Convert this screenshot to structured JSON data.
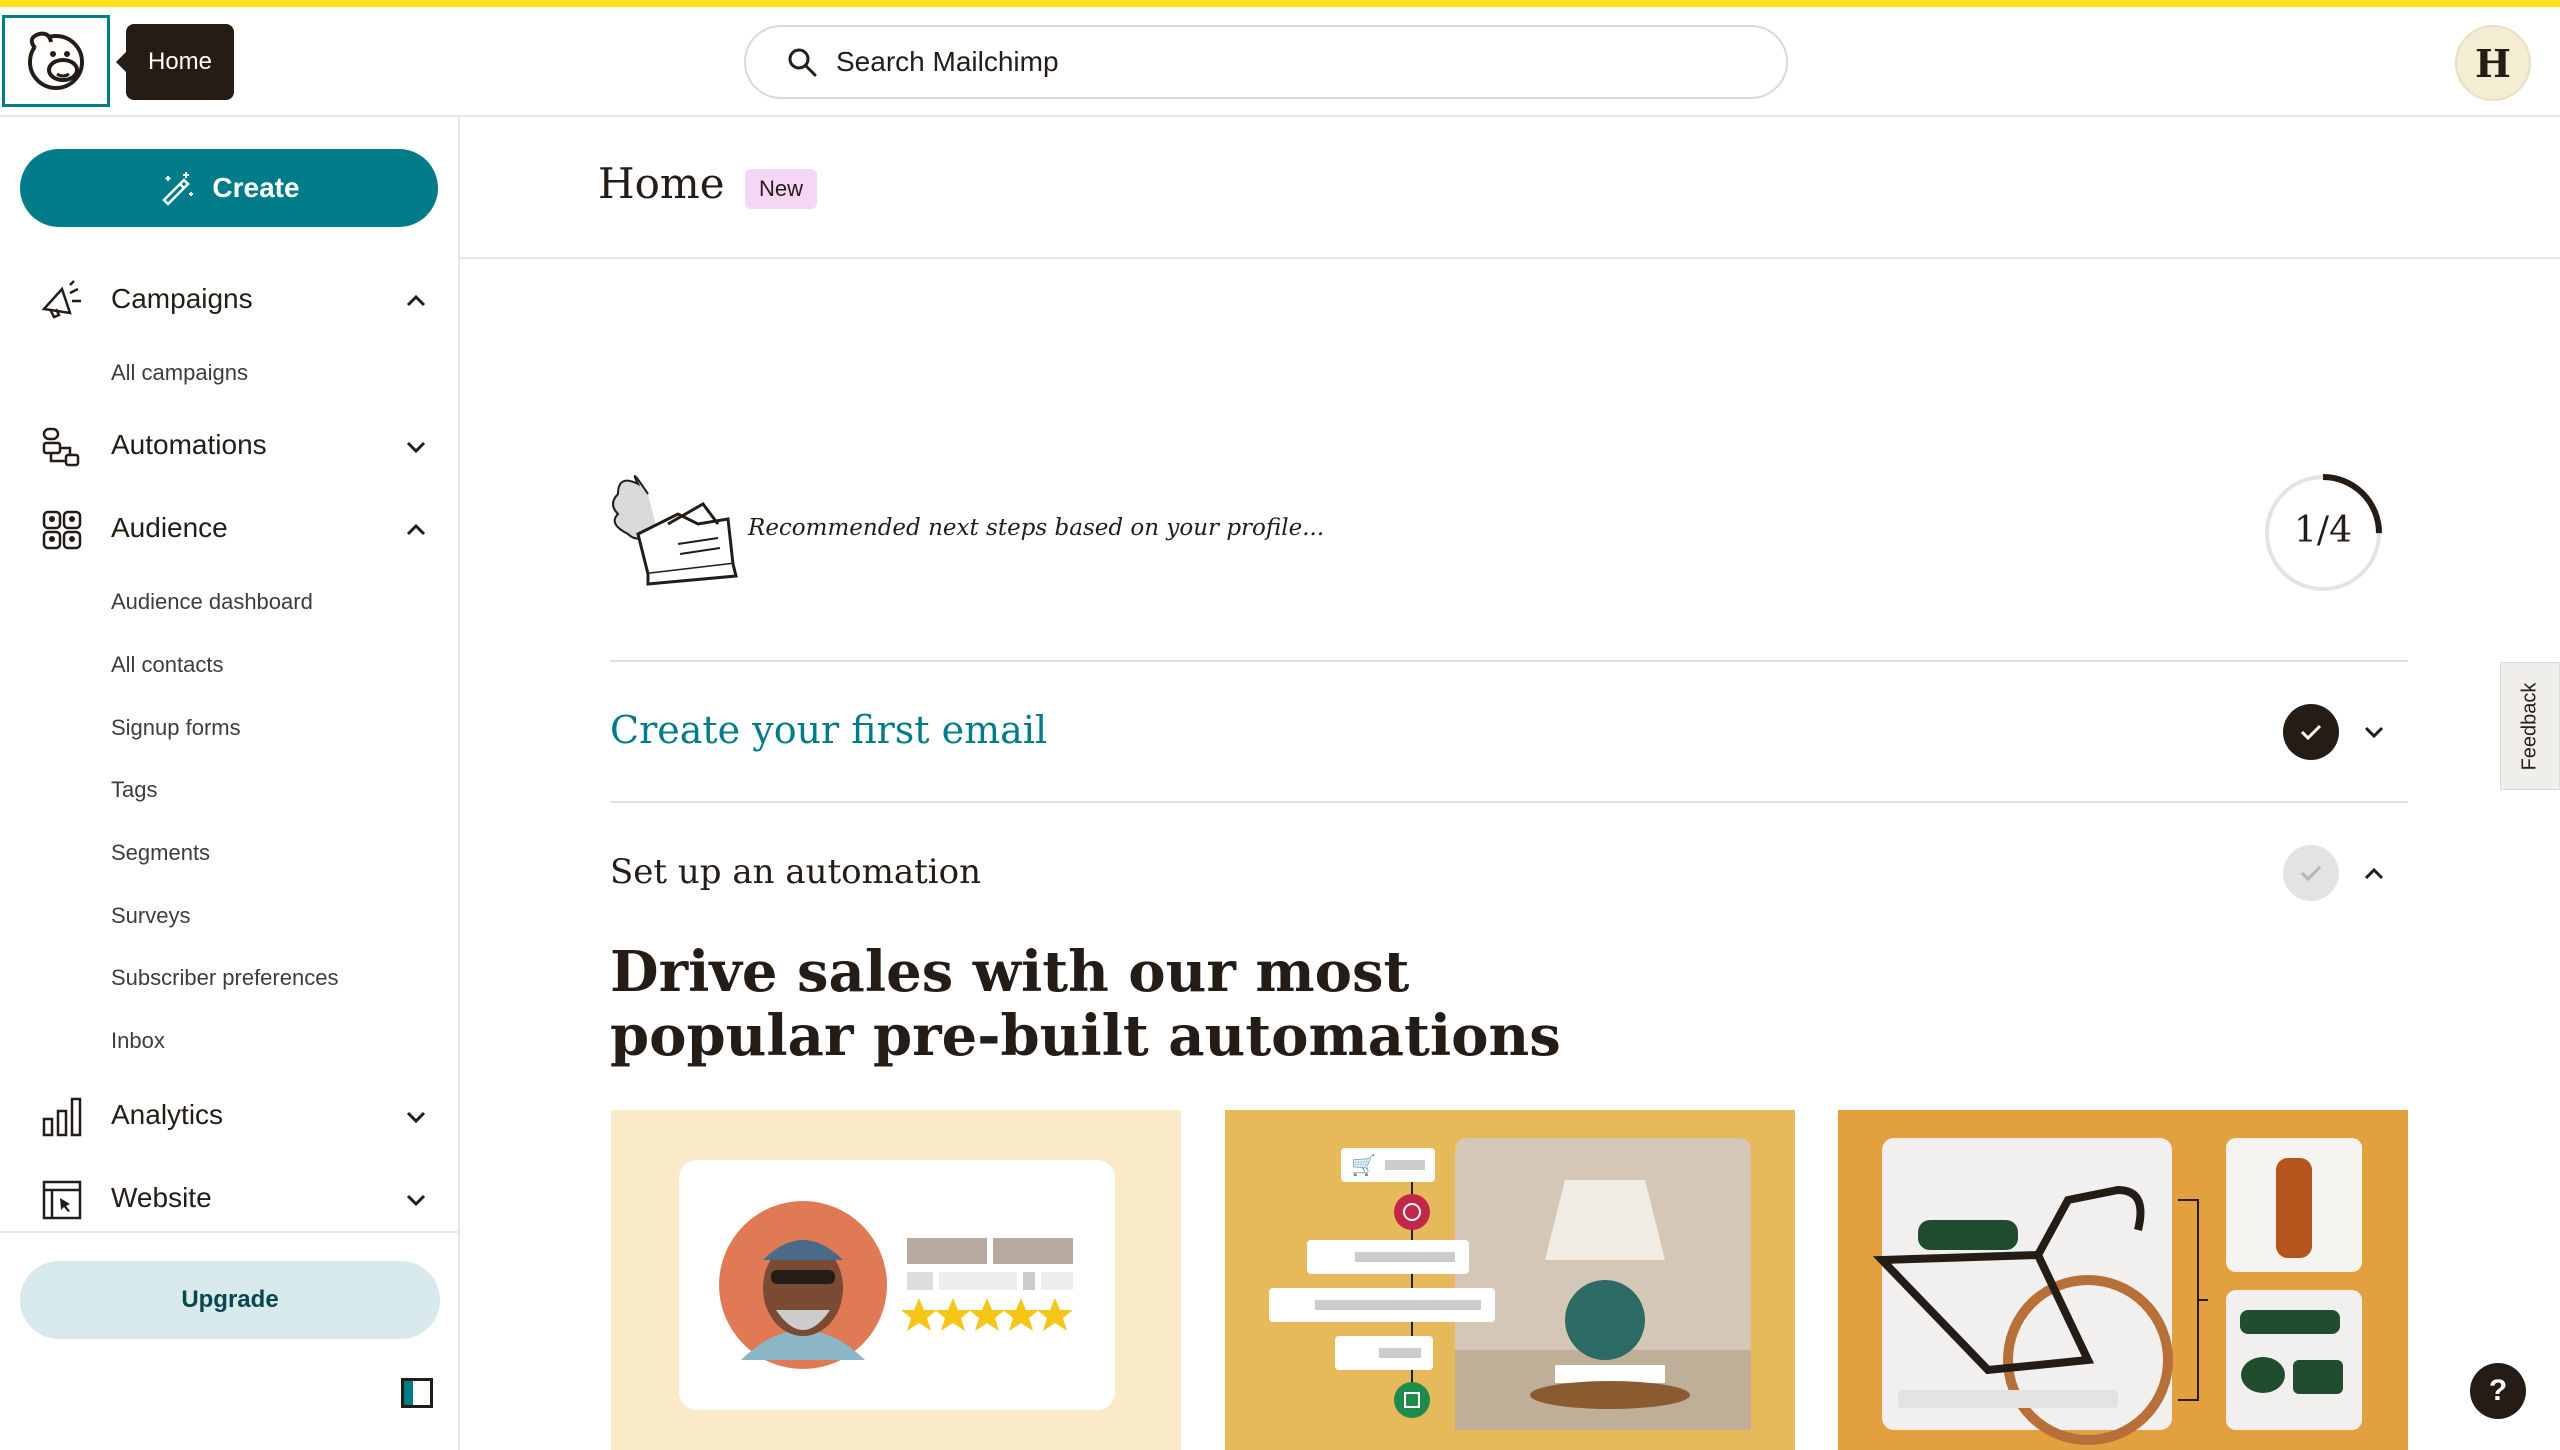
{
  "app": {
    "name": "Mailchimp"
  },
  "topbar": {
    "tooltip": "Home",
    "search_placeholder": "Search Mailchimp",
    "avatar_initial": "H"
  },
  "sidebar": {
    "create_label": "Create",
    "nav": [
      {
        "label": "Campaigns",
        "icon": "megaphone-icon",
        "expanded": true,
        "children": [
          "All campaigns"
        ]
      },
      {
        "label": "Automations",
        "icon": "workflow-icon",
        "expanded": false,
        "children": []
      },
      {
        "label": "Audience",
        "icon": "audience-icon",
        "expanded": true,
        "children": [
          "Audience dashboard",
          "All contacts",
          "Signup forms",
          "Tags",
          "Segments",
          "Surveys",
          "Subscriber preferences",
          "Inbox"
        ]
      },
      {
        "label": "Analytics",
        "icon": "bar-chart-icon",
        "expanded": false,
        "children": []
      },
      {
        "label": "Website",
        "icon": "website-icon",
        "expanded": false,
        "children": []
      }
    ],
    "upgrade_label": "Upgrade"
  },
  "main": {
    "title": "Home",
    "badge": "New",
    "recommend_text": "Recommended next steps based on your profile...",
    "progress": {
      "label": "1/4",
      "fraction": 0.25
    },
    "steps": [
      {
        "title": "Create your first email",
        "done": true,
        "expanded": false
      },
      {
        "title": "Set up an automation",
        "done": false,
        "expanded": true
      }
    ],
    "promo_heading": "Drive sales with our most popular pre-built automations"
  },
  "feedback_label": "Feedback",
  "help_label": "?",
  "colors": {
    "brand_yellow": "#ffe01b",
    "teal": "#007c89",
    "dark": "#241c15",
    "card1": "#fbeac7",
    "card2": "#e6b95b",
    "card3": "#e3a03f"
  }
}
